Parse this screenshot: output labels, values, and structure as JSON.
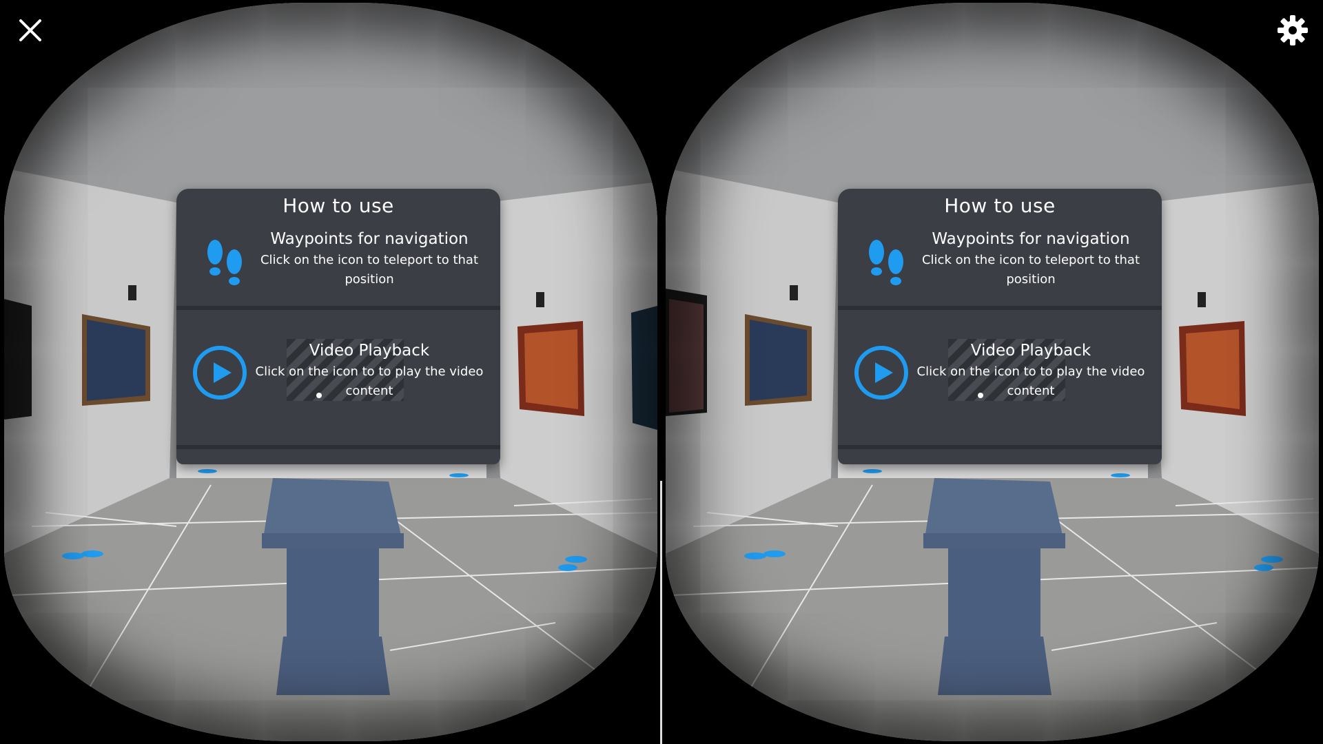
{
  "panel": {
    "title": "How to use",
    "waypoints": {
      "heading": "Waypoints for navigation",
      "description": "Click on the icon to teleport to that position"
    },
    "video": {
      "heading": "Video Playback",
      "description": "Click on the icon to to play the video content"
    }
  },
  "controls": {
    "close_icon": "close-icon",
    "settings_icon": "gear-icon"
  },
  "colors": {
    "accent_blue": "#1f9bf0",
    "panel_bg": "#3b3e44",
    "pedestal": "#4a5f80"
  }
}
